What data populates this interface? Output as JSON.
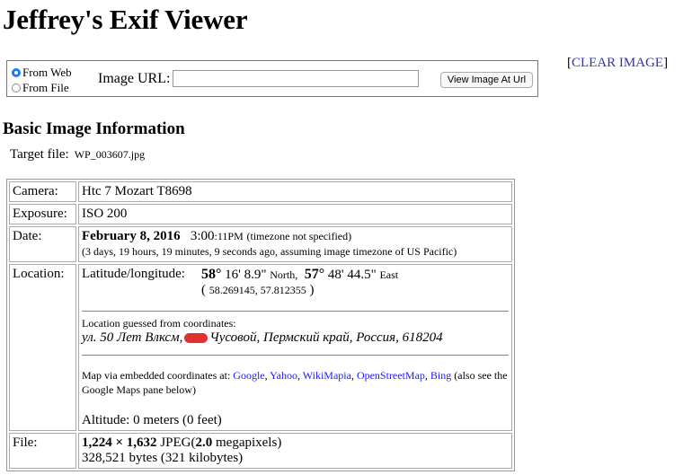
{
  "title": "Jeffrey's Exif Viewer",
  "form": {
    "radio_web": "From Web",
    "radio_file": "From File",
    "url_label": "Image URL:",
    "url_value": "",
    "view_button": "View Image At Url"
  },
  "clear_link": "CLEAR IMAGE",
  "section_title": "Basic Image Information",
  "target": {
    "label": "Target file:",
    "filename": "WP_003607.jpg"
  },
  "rows": {
    "camera": {
      "label": "Camera:",
      "value": "Htc 7 Mozart T8698"
    },
    "exposure": {
      "label": "Exposure:",
      "value": "ISO 200"
    },
    "date": {
      "label": "Date:",
      "date": "February 8, 2016",
      "time_main": "3:00",
      "time_sec": ":11PM",
      "tz_note": "(timezone not specified)",
      "ago": "(3 days, 19 hours, 19 minutes, 9 seconds ago, assuming image timezone of US Pacific)"
    },
    "location": {
      "label": "Location:",
      "latlon_label": "Latitude/longitude:",
      "lat_deg": "58°",
      "lat_rest": "16' 8.9\"",
      "lat_dir": "North,",
      "lon_deg": "57°",
      "lon_rest": "48' 44.5\"",
      "lon_dir": "East",
      "decimal_open": "(",
      "decimal": "58.269145, 57.812355",
      "decimal_close": ")",
      "guessed_label": "Location guessed from coordinates:",
      "address_part1": "ул. 50 Лет Влксм,",
      "address_part2": "Чусовой, Пермский край, Россия, 618204",
      "map_prefix": "Map via embedded coordinates at:",
      "map_links": [
        "Google",
        "Yahoo",
        "WikiMapia",
        "OpenStreetMap",
        "Bing"
      ],
      "map_suffix": "(also see the Google Maps pane below)",
      "altitude": "Altitude: 0 meters (0 feet)"
    },
    "file": {
      "label": "File:",
      "dims": "1,224 × 1,632",
      "format": "JPEG",
      "megapixels_open": "(",
      "megapixels": "2.0",
      "megapixels_unit": "megapixels)",
      "bytes": "328,521 bytes (321 kilobytes)"
    }
  }
}
